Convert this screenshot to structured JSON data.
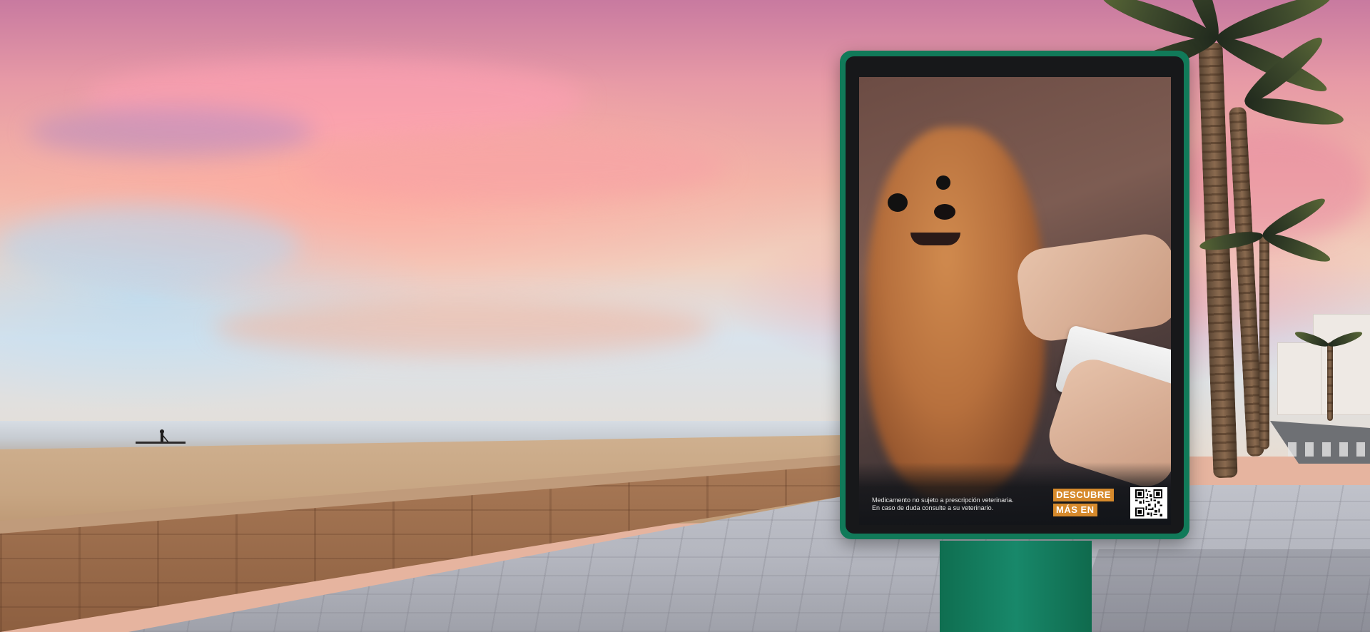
{
  "billboard": {
    "disclaimer_line1": "Medicamento no sujeto a prescripción veterinaria.",
    "disclaimer_line2": "En caso de duda consulte a su veterinario.",
    "cta_line1": "DESCUBRE",
    "cta_line2": "MÁS EN",
    "qr_icon": "qr-code-icon"
  },
  "colors": {
    "billboard_frame": "#117a59",
    "cta_background": "#d68a2c"
  }
}
